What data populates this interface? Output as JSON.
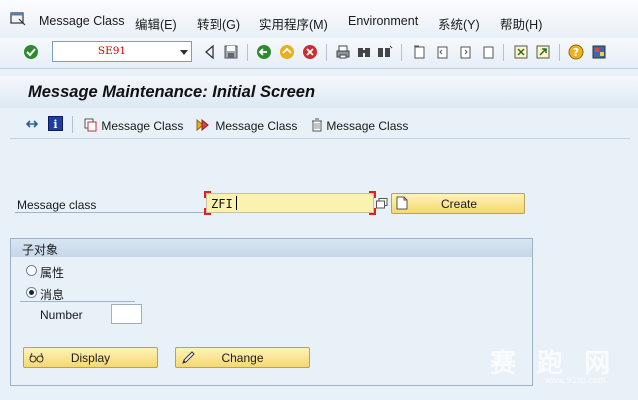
{
  "menubar": {
    "items": [
      "Message Class",
      "编辑(E)",
      "转到(G)",
      "实用程序(M)",
      "Environment",
      "系统(Y)",
      "帮助(H)"
    ]
  },
  "toolbar": {
    "command_field_value": "SE91",
    "icons": [
      "enter-icon",
      "back-icon",
      "save-icon",
      "back-nav-icon",
      "exit-icon",
      "cancel-icon",
      "print-icon",
      "find-icon",
      "find-next-icon",
      "first-page-icon",
      "previous-page-icon",
      "next-page-icon",
      "last-page-icon",
      "new-session-icon",
      "shortcut-icon",
      "help-icon",
      "customize-layout-icon"
    ]
  },
  "page": {
    "title": "Message Maintenance: Initial Screen"
  },
  "app_toolbar": {
    "buttons": [
      "Message Class",
      "Message Class",
      "Message Class"
    ]
  },
  "form": {
    "message_class_label": "Message class",
    "message_class_value": "ZFI",
    "create_label": "Create",
    "subobjects": {
      "title": "子对象",
      "radio_attributes": "属性",
      "radio_messages": "消息",
      "selected": "消息",
      "number_label": "Number",
      "number_value": ""
    },
    "display_label": "Display",
    "change_label": "Change"
  },
  "watermark": {
    "text": "赛 跑 网",
    "url": "www.91sp.com"
  },
  "colors": {
    "input_required": "#fcf2b0",
    "button_yellow": "#f5d870",
    "background": "#e8f0f8",
    "accent_red": "#d22222"
  }
}
